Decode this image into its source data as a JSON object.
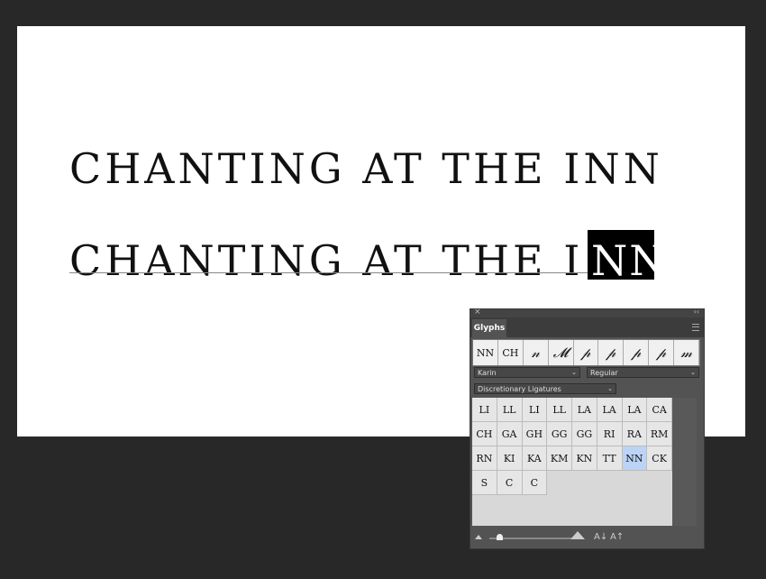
{
  "document": {
    "line1": "CHANTING AT THE INN",
    "line2_main": "CHANTING AT THE I",
    "line2_selected": "NN"
  },
  "panel": {
    "close_glyph": "×",
    "collapse_glyph": "‹‹",
    "tab_label": "Glyphs",
    "recent_glyphs": [
      "NN",
      "CH",
      "𝓃",
      "𝓜",
      "𝓅",
      "𝓅",
      "𝓅",
      "𝓅",
      "𝓂"
    ],
    "font_family": "Karin",
    "font_style": "Regular",
    "show_filter": "Discretionary Ligatures",
    "glyphs": [
      "LI",
      "LL",
      "LI",
      "LL",
      "LA",
      "LA",
      "LA",
      "CA",
      "CH",
      "GA",
      "GH",
      "GG",
      "GG",
      "RI",
      "RA",
      "RM",
      "RN",
      "KI",
      "KA",
      "KM",
      "KN",
      "TT",
      "NN",
      "CK",
      "S",
      "C",
      "C"
    ],
    "highlight_index": 22,
    "font_size_small_icon": "small-mountain-icon",
    "font_size_large_icon": "large-mountain-icon",
    "decrease_label": "A↓",
    "increase_label": "A↑"
  }
}
